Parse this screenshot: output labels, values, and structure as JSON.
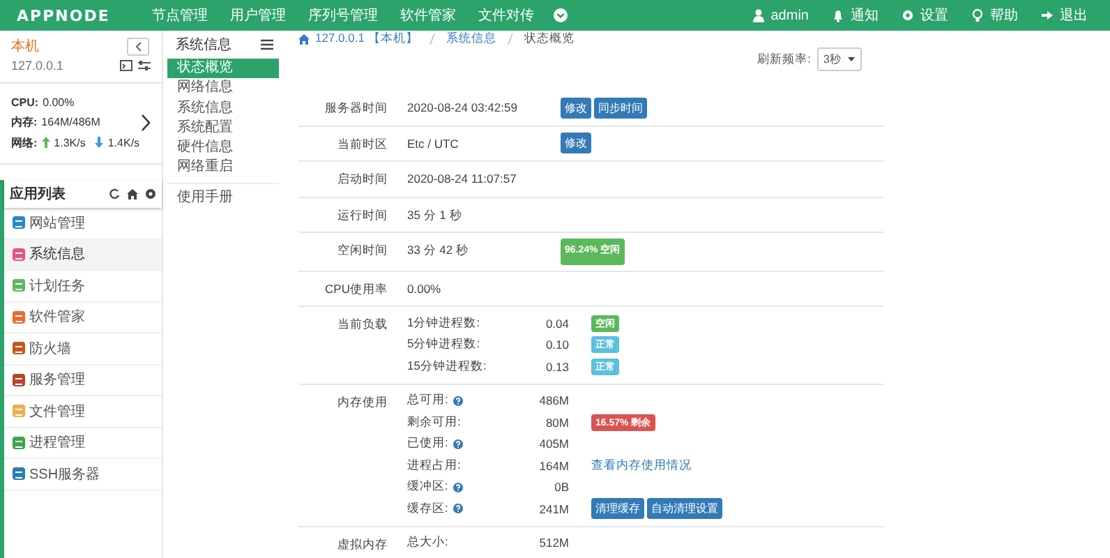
{
  "topbar": {
    "logo": "APPNODE",
    "nav": [
      {
        "label": "节点管理"
      },
      {
        "label": "用户管理"
      },
      {
        "label": "序列号管理"
      },
      {
        "label": "软件管家"
      },
      {
        "label": "文件对传"
      }
    ],
    "user_menu": [
      {
        "kind": "user",
        "label": "admin"
      },
      {
        "kind": "bell",
        "label": "通知"
      },
      {
        "kind": "gear",
        "label": "设置"
      },
      {
        "kind": "bulb",
        "label": "帮助"
      },
      {
        "kind": "exit",
        "label": "退出"
      }
    ]
  },
  "node_panel": {
    "name": "本机",
    "address": "127.0.0.1",
    "stats": [
      {
        "label": "CPU:",
        "value": "0.00%"
      },
      {
        "label": "内存:",
        "value": "164M/486M"
      }
    ],
    "network": {
      "label": "网络:",
      "up": "1.3K/s",
      "down": "1.4K/s"
    }
  },
  "app_list": {
    "title": "应用列表",
    "items": [
      {
        "label": "网站管理",
        "color": "#2a86c8",
        "selected": false
      },
      {
        "label": "系统信息",
        "color": "#e8508a",
        "selected": true
      },
      {
        "label": "计划任务",
        "color": "#5cb85c",
        "selected": false
      },
      {
        "label": "软件管家",
        "color": "#e86a2c",
        "selected": false
      },
      {
        "label": "防火墙",
        "color": "#c8571e",
        "selected": false
      },
      {
        "label": "服务管理",
        "color": "#b8442a",
        "selected": false
      },
      {
        "label": "文件管理",
        "color": "#f0ad4e",
        "selected": false
      },
      {
        "label": "进程管理",
        "color": "#3aa84a",
        "selected": false
      },
      {
        "label": "SSH服务器",
        "color": "#2a7fb0",
        "selected": false
      }
    ]
  },
  "submenu": {
    "title": "系统信息",
    "items": [
      {
        "label": "状态概览",
        "selected": true
      },
      {
        "label": "网络信息",
        "selected": false
      },
      {
        "label": "系统信息",
        "selected": false
      },
      {
        "label": "系统配置",
        "selected": false
      },
      {
        "label": "硬件信息",
        "selected": false
      },
      {
        "label": "网络重启",
        "selected": false
      }
    ],
    "extra": [
      {
        "label": "使用手册"
      }
    ]
  },
  "breadcrumb": [
    "127.0.0.1 【本机】",
    "系统信息",
    "状态概览"
  ],
  "refresh": {
    "label": "刷新频率:",
    "value": "3秒"
  },
  "info_rows": [
    {
      "label": "服务器时间",
      "value": "2020-08-24 03:42:59",
      "buttons": [
        "修改",
        "同步时间"
      ]
    },
    {
      "label": "当前时区",
      "value": "Etc / UTC",
      "buttons": [
        "修改"
      ]
    },
    {
      "label": "启动时间",
      "value": "2020-08-24 11:07:57"
    },
    {
      "label": "运行时间",
      "value": "35 分 1 秒"
    },
    {
      "label": "空闲时间",
      "value": "33 分 42 秒",
      "badge": {
        "text": "96.24% 空闲",
        "kind": "success"
      }
    },
    {
      "label": "CPU使用率",
      "value": "0.00%"
    },
    {
      "label": "当前负载",
      "lines": [
        {
          "label": "1分钟进程数:",
          "value": "0.04",
          "badge": {
            "text": "空闲",
            "kind": "success"
          }
        },
        {
          "label": "5分钟进程数:",
          "value": "0.10",
          "badge": {
            "text": "正常",
            "kind": "info"
          }
        },
        {
          "label": "15分钟进程数:",
          "value": "0.13",
          "badge": {
            "text": "正常",
            "kind": "info"
          }
        }
      ]
    },
    {
      "label": "内存使用",
      "lines": [
        {
          "label": "总可用:",
          "help": true,
          "value": "486M"
        },
        {
          "label": "剩余可用:",
          "help": false,
          "value": "80M",
          "badge": {
            "text": "16.57% 剩余",
            "kind": "danger"
          }
        },
        {
          "label": "已使用:",
          "help": true,
          "value": "405M"
        },
        {
          "label": "进程占用:",
          "help": false,
          "value": "164M",
          "link": "查看内存使用情况"
        },
        {
          "label": "缓冲区:",
          "help": true,
          "value": "0B"
        },
        {
          "label": "缓存区:",
          "help": true,
          "value": "241M",
          "buttons": [
            "清理缓存",
            "自动清理设置"
          ]
        }
      ]
    },
    {
      "label": "虚拟内存",
      "lines": [
        {
          "label": "总大小:",
          "help": false,
          "value": "512M"
        }
      ]
    }
  ]
}
